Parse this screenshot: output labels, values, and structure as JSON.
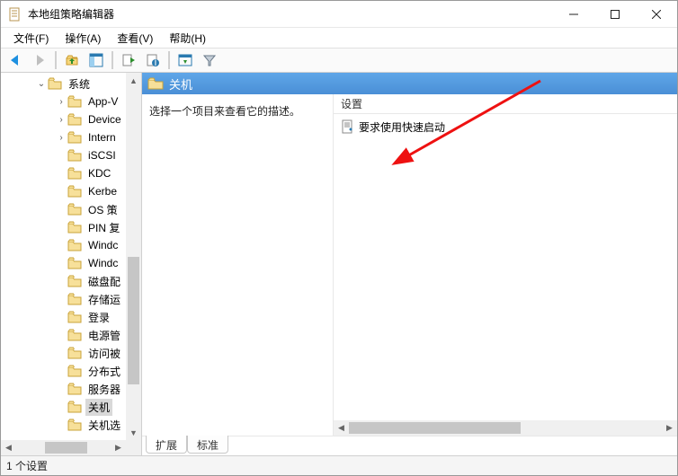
{
  "window": {
    "title": "本地组策略编辑器"
  },
  "menu": {
    "file": "文件(F)",
    "action": "操作(A)",
    "view": "查看(V)",
    "help": "帮助(H)"
  },
  "tree": {
    "root": "系统",
    "items": [
      "App-V",
      "Device",
      "Intern",
      "iSCSI",
      "KDC",
      "Kerbe",
      "OS 策",
      "PIN 复",
      "Windc",
      "Windc",
      "磁盘配",
      "存储运",
      "登录",
      "电源管",
      "访问被",
      "分布式",
      "服务器",
      "关机",
      "关机选"
    ],
    "selected": "关机"
  },
  "header": {
    "title": "关机"
  },
  "description": {
    "prompt": "选择一个项目来查看它的描述。"
  },
  "list": {
    "column": "设置",
    "items": [
      "要求使用快速启动"
    ]
  },
  "tabs": {
    "extended": "扩展",
    "standard": "标准"
  },
  "status": {
    "text": "1 个设置"
  }
}
